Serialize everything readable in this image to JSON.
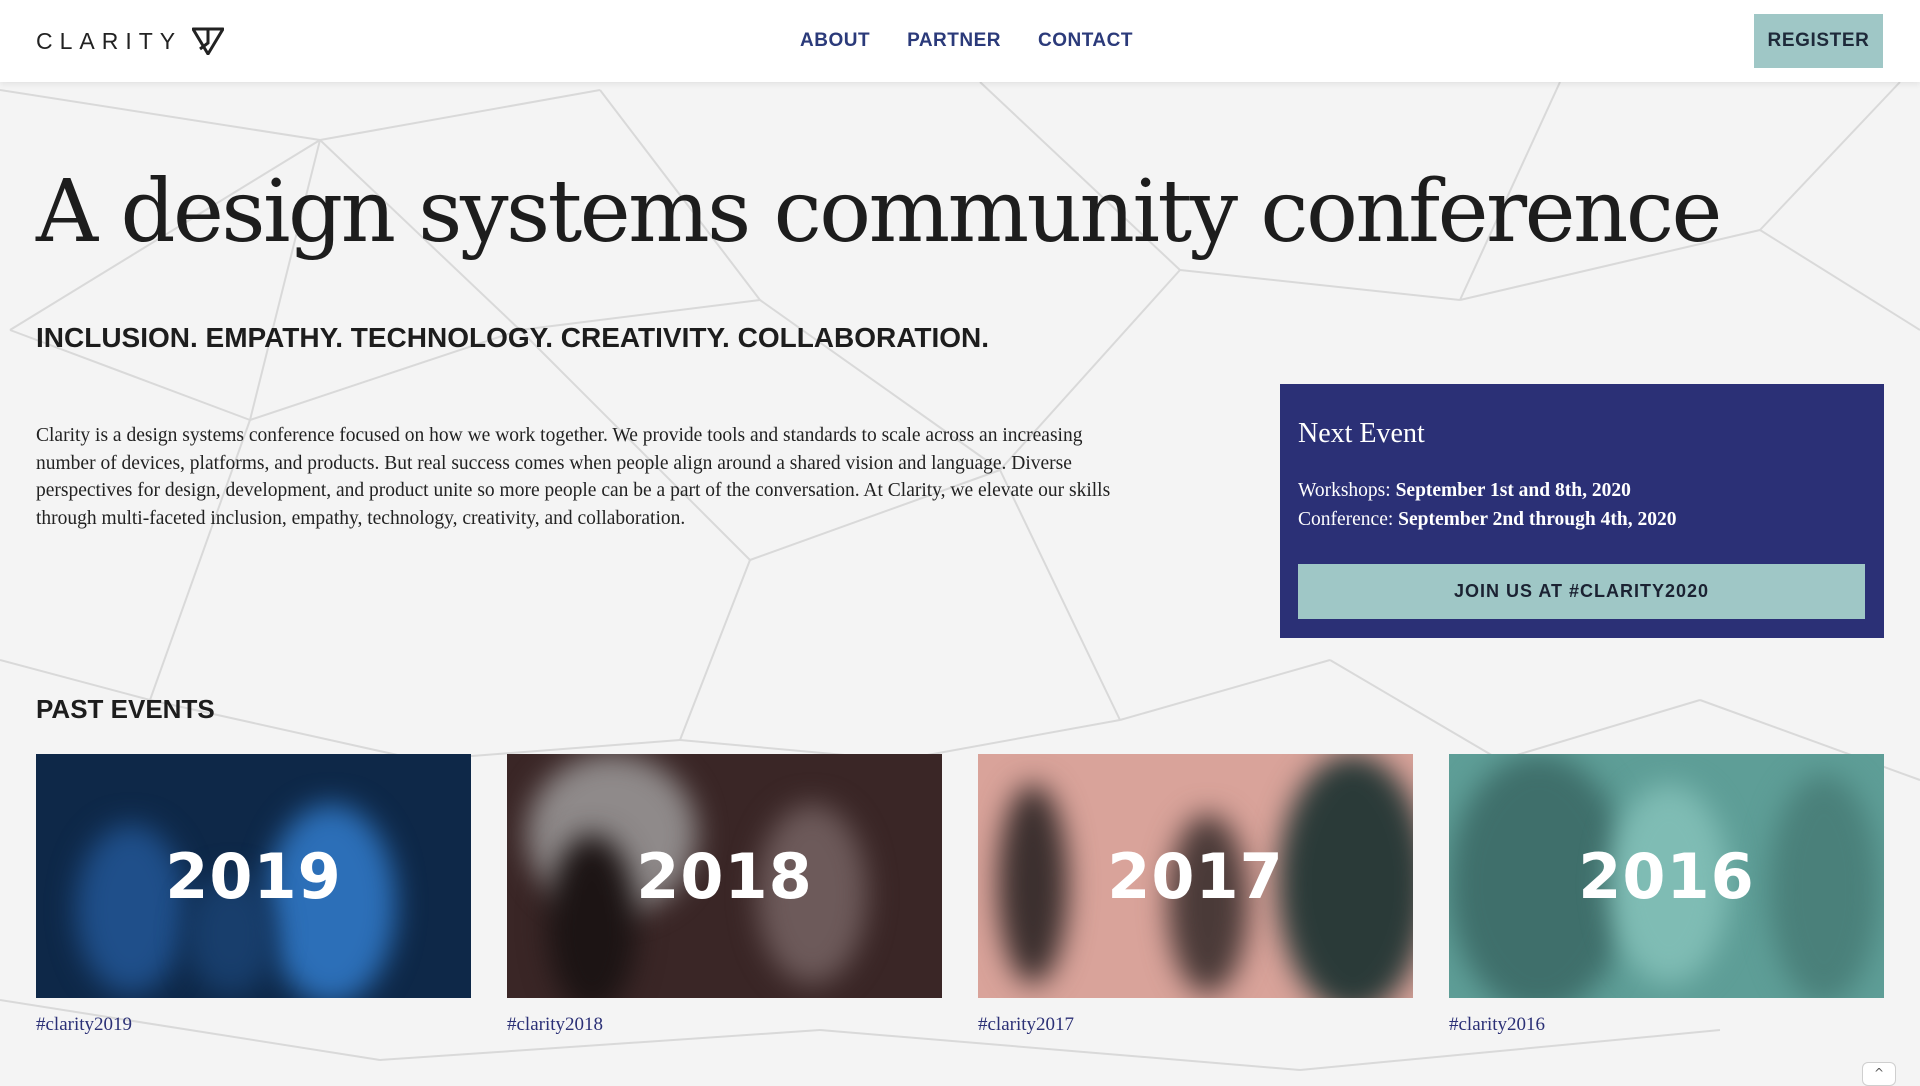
{
  "brand": {
    "name": "CLARITY",
    "logo_icon": "clarity-arrow-icon"
  },
  "nav": {
    "items": [
      "ABOUT",
      "PARTNER",
      "CONTACT"
    ],
    "register": "REGISTER"
  },
  "hero": {
    "title": "A design systems community conference",
    "tagline": "INCLUSION. EMPATHY. TECHNOLOGY. CREATIVITY. COLLABORATION.",
    "intro": "Clarity is a design systems conference focused on how we work together. We provide tools and standards to scale across an increasing number of devices, platforms, and products. But real success comes when people align around a shared vision and language. Diverse perspectives for design, development, and product unite so more people can be a part of the conversation. At Clarity, we elevate our skills through multi-faceted inclusion, empathy, technology, creativity, and collaboration."
  },
  "next_event": {
    "title": "Next Event",
    "workshops_label": "Workshops:",
    "workshops_dates": "September 1st and 8th, 2020",
    "conference_label": "Conference:",
    "conference_dates": "September 2nd through 4th, 2020",
    "cta": "JOIN US AT #CLARITY2020"
  },
  "past_events": {
    "heading": "PAST EVENTS",
    "items": [
      {
        "year": "2019",
        "tag": "#clarity2019"
      },
      {
        "year": "2018",
        "tag": "#clarity2018"
      },
      {
        "year": "2017",
        "tag": "#clarity2017"
      },
      {
        "year": "2016",
        "tag": "#clarity2016"
      }
    ]
  },
  "colors": {
    "accent_navy": "#2b3076",
    "accent_teal": "#9fc7c6",
    "nav_text": "#2b3a7a",
    "card_2019": "#0e2848",
    "card_2018": "#3a2626",
    "card_2017": "#d9a39a",
    "card_2016": "#5e9e97"
  },
  "scroll_top": {
    "icon": "chevron-up-icon",
    "glyph": "^"
  }
}
